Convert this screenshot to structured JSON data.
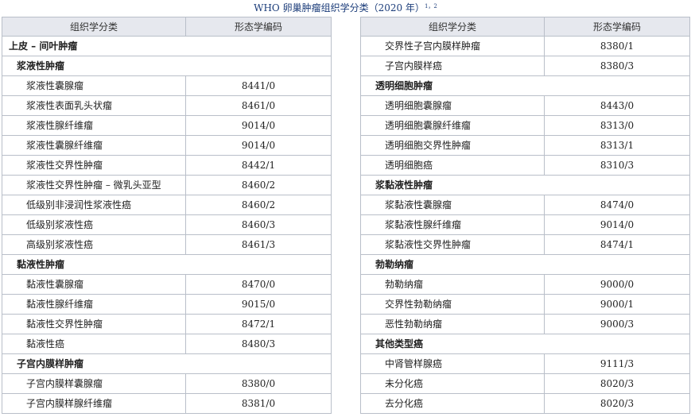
{
  "title": {
    "text": "WHO 卵巢肿瘤组织学分类（2020 年）",
    "superscript": "1，2"
  },
  "headers": {
    "classification": "组织学分类",
    "code": "形态学编码"
  },
  "left": {
    "group_epithelial": "上皮 – 间叶肿瘤",
    "serous": {
      "label": "浆液性肿瘤",
      "items": [
        {
          "name": "浆液性囊腺瘤",
          "code": "8441/0"
        },
        {
          "name": "浆液性表面乳头状瘤",
          "code": "8461/0"
        },
        {
          "name": "浆液性腺纤维瘤",
          "code": "9014/0"
        },
        {
          "name": "浆液性囊腺纤维瘤",
          "code": "9014/0"
        },
        {
          "name": "浆液性交界性肿瘤",
          "code": "8442/1"
        },
        {
          "name": "浆液性交界性肿瘤 – 微乳头亚型",
          "code": "8460/2"
        },
        {
          "name": "低级别非浸润性浆液性癌",
          "code": "8460/2"
        },
        {
          "name": "低级别浆液性癌",
          "code": "8460/3"
        },
        {
          "name": "高级别浆液性癌",
          "code": "8461/3"
        }
      ]
    },
    "mucinous": {
      "label": "黏液性肿瘤",
      "items": [
        {
          "name": "黏液性囊腺瘤",
          "code": "8470/0"
        },
        {
          "name": "黏液性腺纤维瘤",
          "code": "9015/0"
        },
        {
          "name": "黏液性交界性肿瘤",
          "code": "8472/1"
        },
        {
          "name": "黏液性癌",
          "code": "8480/3"
        }
      ]
    },
    "endometrioid": {
      "label": "子宫内膜样肿瘤",
      "items": [
        {
          "name": "子宫内膜样囊腺瘤",
          "code": "8380/0"
        },
        {
          "name": "子宫内膜样腺纤维瘤",
          "code": "8381/0"
        }
      ]
    }
  },
  "right": {
    "endometrioid_cont": {
      "items": [
        {
          "name": "交界性子宫内膜样肿瘤",
          "code": "8380/1"
        },
        {
          "name": "子宫内膜样癌",
          "code": "8380/3"
        }
      ]
    },
    "clear_cell": {
      "label": "透明细胞肿瘤",
      "items": [
        {
          "name": "透明细胞囊腺瘤",
          "code": "8443/0"
        },
        {
          "name": "透明细胞囊腺纤维瘤",
          "code": "8313/0"
        },
        {
          "name": "透明细胞交界性肿瘤",
          "code": "8313/1"
        },
        {
          "name": "透明细胞癌",
          "code": "8310/3"
        }
      ]
    },
    "seromucinous": {
      "label": "浆黏液性肿瘤",
      "items": [
        {
          "name": "浆黏液性囊腺瘤",
          "code": "8474/0"
        },
        {
          "name": "浆黏液性腺纤维瘤",
          "code": "9014/0"
        },
        {
          "name": "浆黏液性交界性肿瘤",
          "code": "8474/1"
        }
      ]
    },
    "brenner": {
      "label": "勃勒纳瘤",
      "items": [
        {
          "name": "勃勒纳瘤",
          "code": "9000/0"
        },
        {
          "name": "交界性勃勒纳瘤",
          "code": "9000/1"
        },
        {
          "name": "恶性勃勒纳瘤",
          "code": "9000/3"
        }
      ]
    },
    "other": {
      "label": "其他类型癌",
      "items": [
        {
          "name": "中肾管样腺癌",
          "code": "9111/3"
        },
        {
          "name": "未分化癌",
          "code": "8020/3"
        },
        {
          "name": "去分化癌",
          "code": "8020/3"
        }
      ]
    }
  }
}
